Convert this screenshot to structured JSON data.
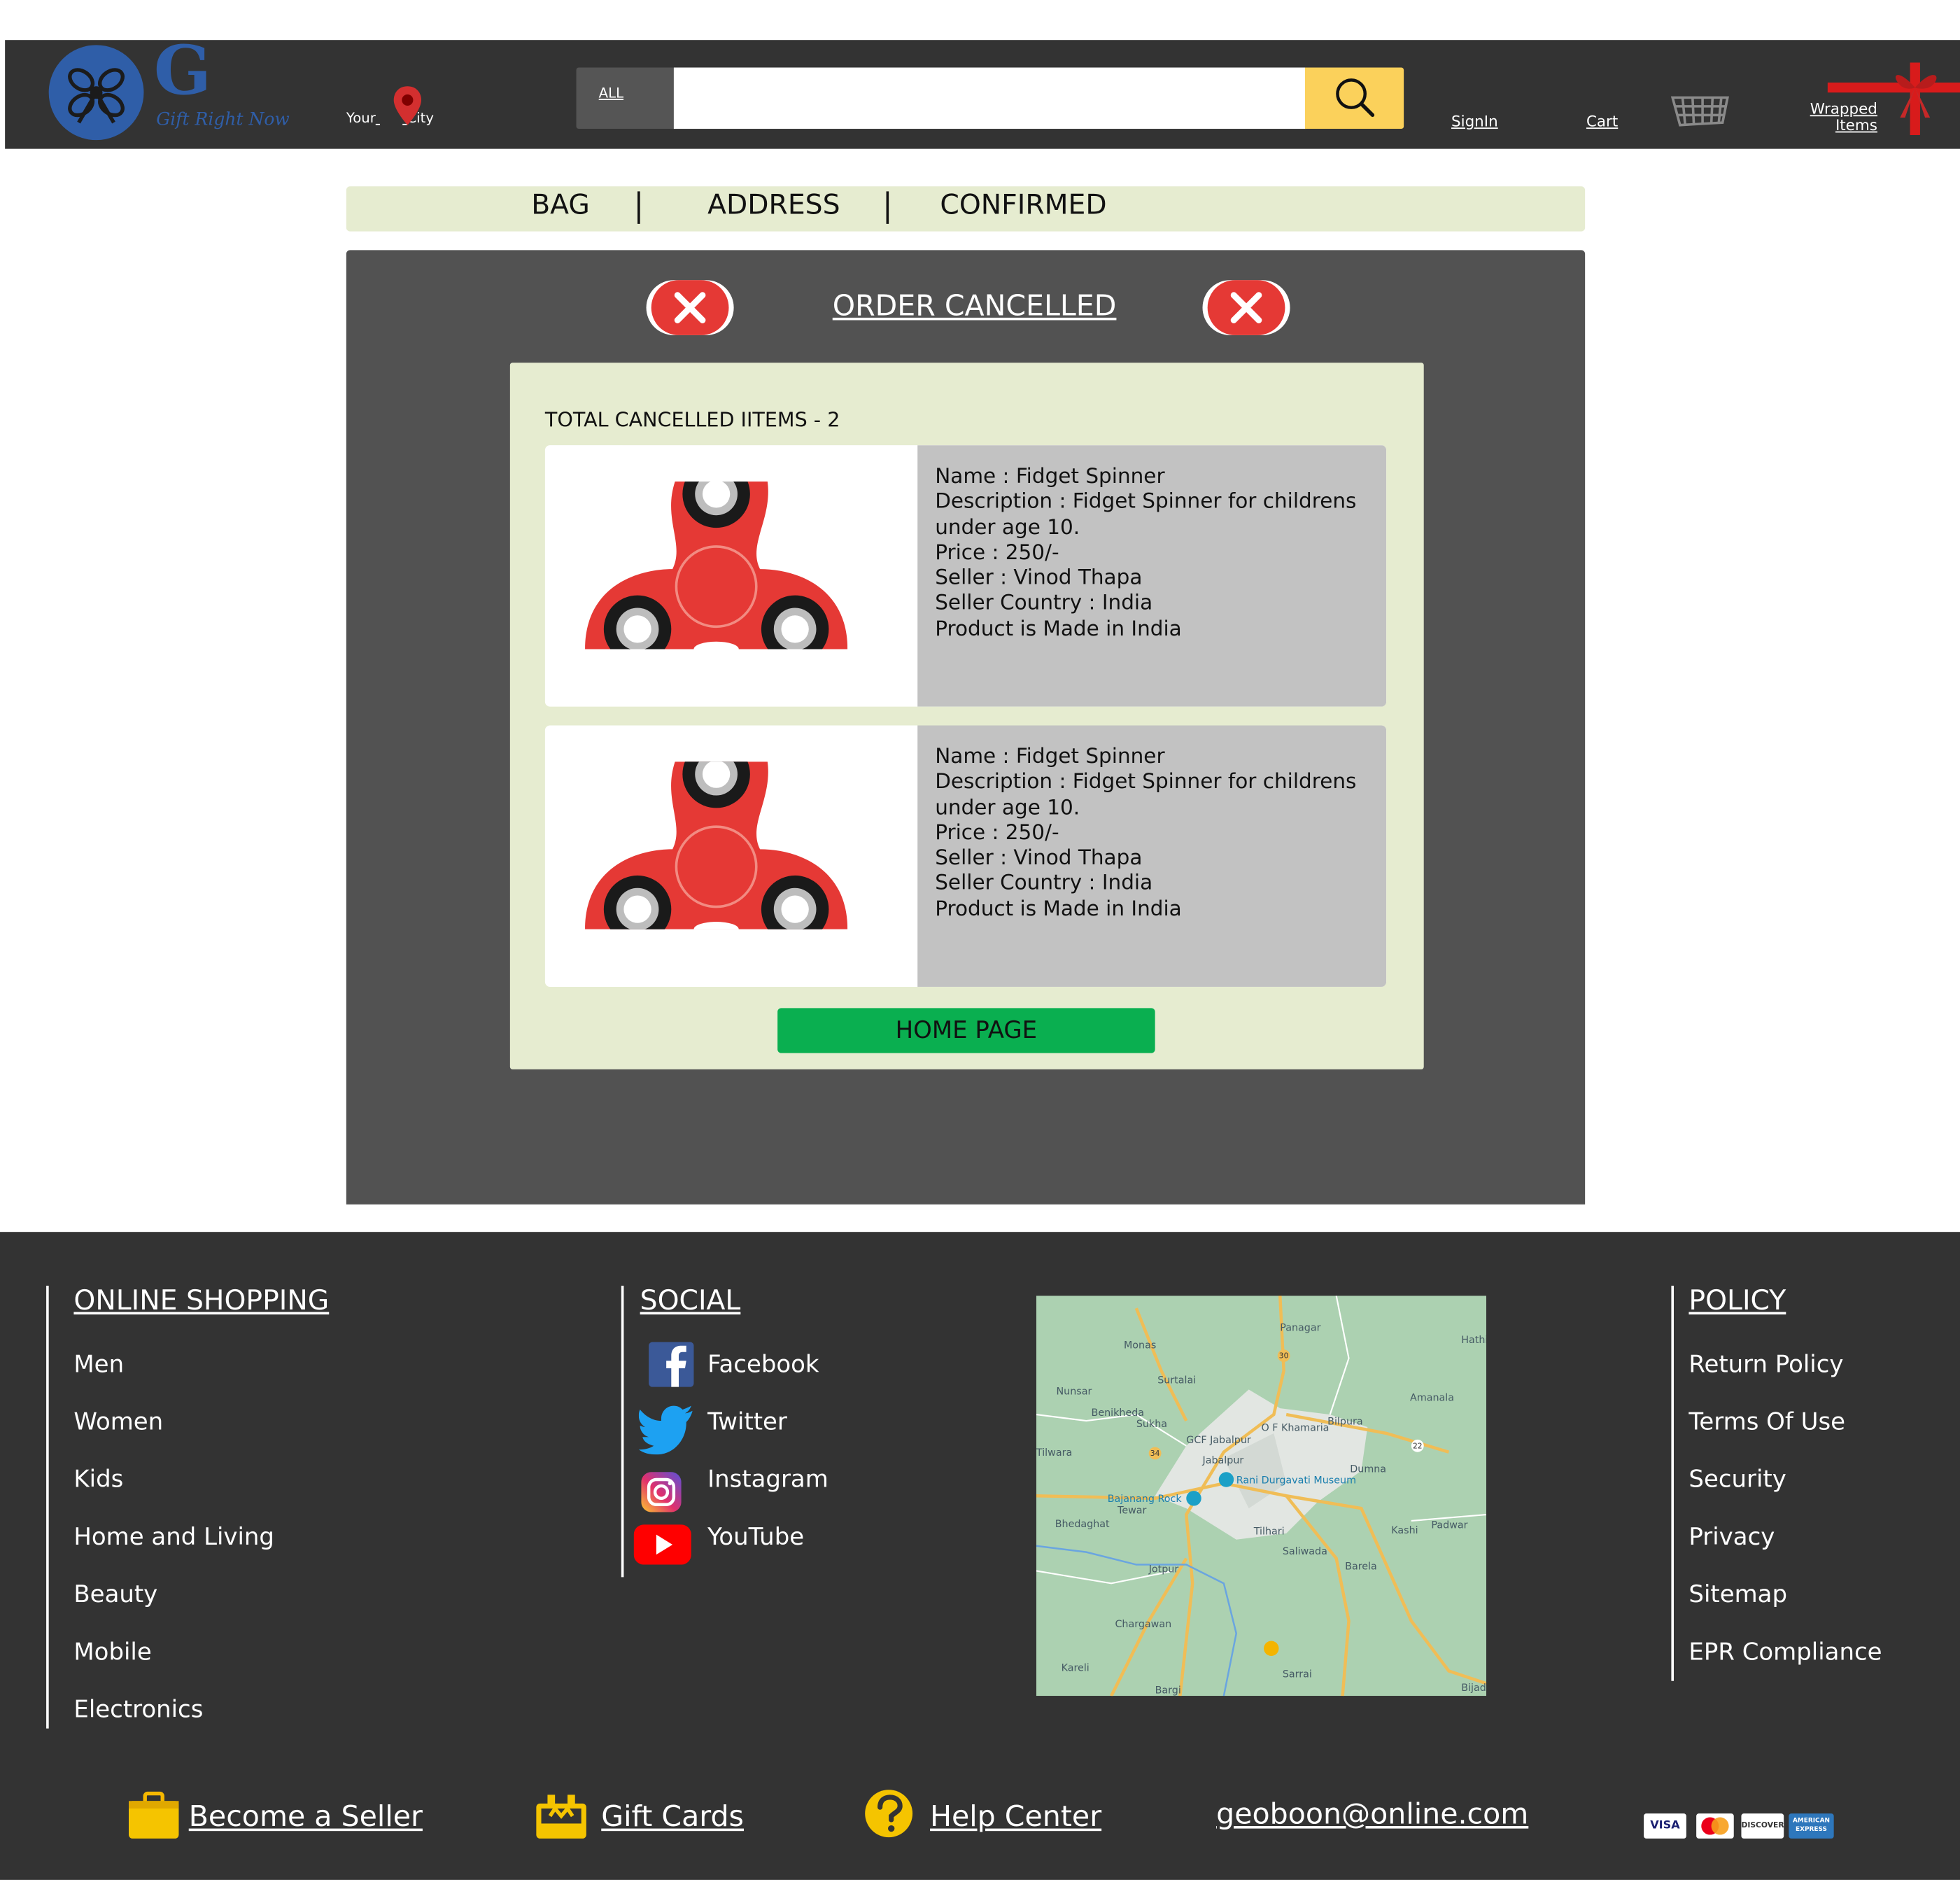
{
  "header": {
    "logo_letter": "G",
    "logo_tagline": "Gift Right Now",
    "location_word1": "Your",
    "location_word2": "City",
    "search_category": "ALL",
    "search_placeholder": "",
    "signin_label": "SignIn",
    "cart_label": "Cart",
    "wrapped_line1": "Wrapped",
    "wrapped_line2": "Items"
  },
  "steps": [
    "BAG",
    "ADDRESS",
    "CONFIRMED"
  ],
  "panel": {
    "title": "ORDER CANCELLED",
    "total_label": "TOTAL CANCELLED IITEMS - 2",
    "items": [
      {
        "name": "Name : Fidget Spinner",
        "description": "Description : Fidget Spinner for childrens under age 10.",
        "price": "Price : 250/-",
        "seller": "Seller : Vinod Thapa",
        "country": "Seller Country : India",
        "made_in": "Product is Made in India"
      },
      {
        "name": "Name : Fidget Spinner",
        "description": "Description : Fidget Spinner for childrens under age 10.",
        "price": "Price : 250/-",
        "seller": "Seller : Vinod Thapa",
        "country": "Seller Country : India",
        "made_in": "Product is Made in India"
      }
    ],
    "home_button": "HOME PAGE"
  },
  "footer": {
    "shopping": {
      "title": "ONLINE SHOPPING",
      "links": [
        "Men",
        "Women",
        "Kids",
        "Home and Living",
        "Beauty",
        "Mobile",
        "Electronics"
      ]
    },
    "social": {
      "title": "SOCIAL",
      "links": [
        "Facebook",
        "Twitter",
        "Instagram",
        "YouTube"
      ]
    },
    "map": {
      "labels": [
        "Panagar",
        "Monas",
        "Surtalai",
        "Nunsar",
        "Benikheda",
        "Sukha",
        "O F Khamaria",
        "Bilpura",
        "Amanala",
        "GCF Jabalpur",
        "Jabalpur",
        "Tilwara",
        "Rani Durgavati Museum",
        "Dumna",
        "Bajanang Rock",
        "Tewar",
        "Bhedaghat",
        "Tilhari",
        "Kashi",
        "Padwar",
        "Saliwada",
        "Barela",
        "Jotpur",
        "Chargawan",
        "Kareli",
        "Sarrai",
        "Bargi",
        "Bijadi",
        "Hathi"
      ],
      "road_numbers": [
        "30",
        "34",
        "22"
      ]
    },
    "policy": {
      "title": "POLICY",
      "links": [
        "Return Policy",
        "Terms Of Use",
        "Security",
        "Privacy",
        "Sitemap",
        "EPR Compliance"
      ]
    },
    "bottom": {
      "seller": "Become a Seller",
      "gift_cards": "Gift Cards",
      "help": "Help Center",
      "email": "geoboon@online.com"
    },
    "payment_cards": [
      "VISA",
      "MasterCard",
      "DISCOVER",
      "AMERICAN EXPRESS"
    ]
  },
  "colors": {
    "header_bg": "#333333",
    "brand_blue": "#2f5ea8",
    "search_button": "#fbd15b",
    "steps_bg": "#e6ecd0",
    "panel_bg": "#525252",
    "cancel_red": "#e53935",
    "home_button": "#0aaf50",
    "item_info_bg": "#c2c2c2"
  },
  "icons": [
    "gift-bow-icon",
    "location-pin-icon",
    "search-icon",
    "shopping-cart-icon",
    "red-ribbon-icon",
    "cancel-x-icon",
    "fidget-spinner-image",
    "facebook-icon",
    "twitter-icon",
    "instagram-icon",
    "youtube-icon",
    "briefcase-icon",
    "gift-box-icon",
    "question-icon"
  ]
}
